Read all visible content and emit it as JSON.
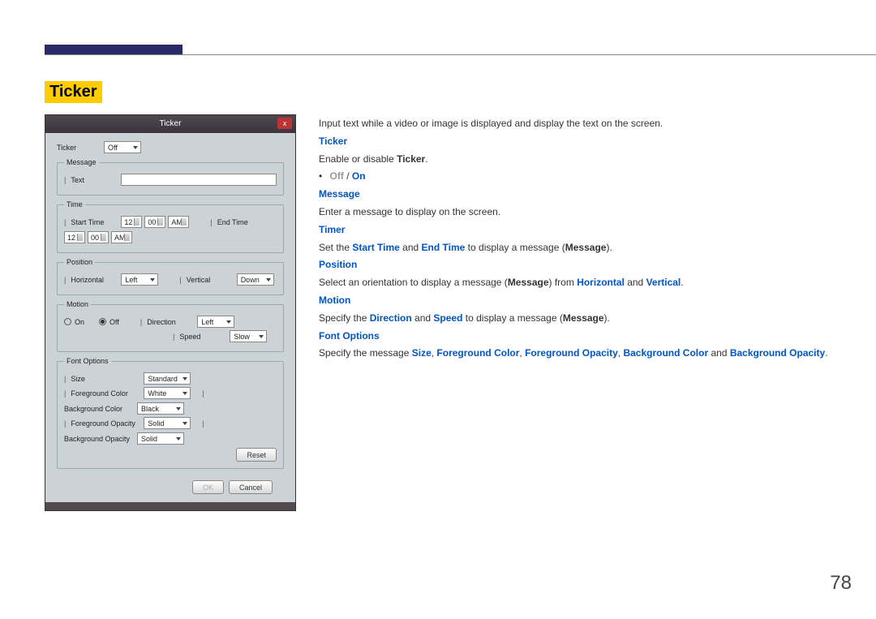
{
  "page_number": "78",
  "section_title": "Ticker",
  "intro": "Input text while a video or image is displayed and display the text on the screen.",
  "desc": {
    "ticker_h": "Ticker",
    "ticker_t1": "Enable or disable ",
    "ticker_b": "Ticker",
    "off": "Off",
    "on": "On",
    "message_h": "Message",
    "message_t": "Enter a message to display on the screen.",
    "timer_h": "Timer",
    "timer_t1": "Set the ",
    "timer_k1": "Start Time",
    "timer_t2": " and ",
    "timer_k2": "End Time",
    "timer_t3": " to display a message (",
    "timer_k3": "Message",
    "timer_t4": ").",
    "position_h": "Position",
    "position_t1": "Select an orientation to display a message (",
    "position_k1": "Message",
    "position_t2": ") from ",
    "position_k2": "Horizontal",
    "position_t3": " and ",
    "position_k3": "Vertical",
    "position_t4": ".",
    "motion_h": "Motion",
    "motion_t1": "Specify the ",
    "motion_k1": "Direction",
    "motion_t2": " and ",
    "motion_k2": "Speed",
    "motion_t3": " to display a message (",
    "motion_k3": "Message",
    "motion_t4": ").",
    "font_h": "Font Options",
    "font_t1": "Specify the message ",
    "font_k1": "Size",
    "font_c1": ", ",
    "font_k2": "Foreground Color",
    "font_c2": ", ",
    "font_k3": "Foreground Opacity",
    "font_c3": ", ",
    "font_k4": "Background Color",
    "font_t2": " and ",
    "font_k5": "Background Opacity",
    "font_t3": "."
  },
  "dialog": {
    "title": "Ticker",
    "close": "x",
    "ticker_lbl": "Ticker",
    "ticker_val": "Off",
    "message_legend": "Message",
    "message_lbl": "Text",
    "time_legend": "Time",
    "start_time_lbl": "Start Time",
    "end_time_lbl": "End Time",
    "hh1": "12",
    "mm1": "00",
    "ap1": "AM",
    "hh2": "12",
    "mm2": "00",
    "ap2": "AM",
    "position_legend": "Position",
    "horizontal_lbl": "Horizontal",
    "horizontal_val": "Left",
    "vertical_lbl": "Vertical",
    "vertical_val": "Down",
    "motion_legend": "Motion",
    "motion_on": "On",
    "motion_off": "Off",
    "direction_lbl": "Direction",
    "direction_val": "Left",
    "speed_lbl": "Speed",
    "speed_val": "Slow",
    "font_legend": "Font Options",
    "size_lbl": "Size",
    "size_val": "Standard",
    "fgcolor_lbl": "Foreground Color",
    "fgcolor_val": "White",
    "bgcolor_lbl": "Background Color",
    "bgcolor_val": "Black",
    "fgopacity_lbl": "Foreground Opacity",
    "fgopacity_val": "Solid",
    "bgopacity_lbl": "Background Opacity",
    "bgopacity_val": "Solid",
    "reset": "Reset",
    "ok": "OK",
    "cancel": "Cancel"
  }
}
